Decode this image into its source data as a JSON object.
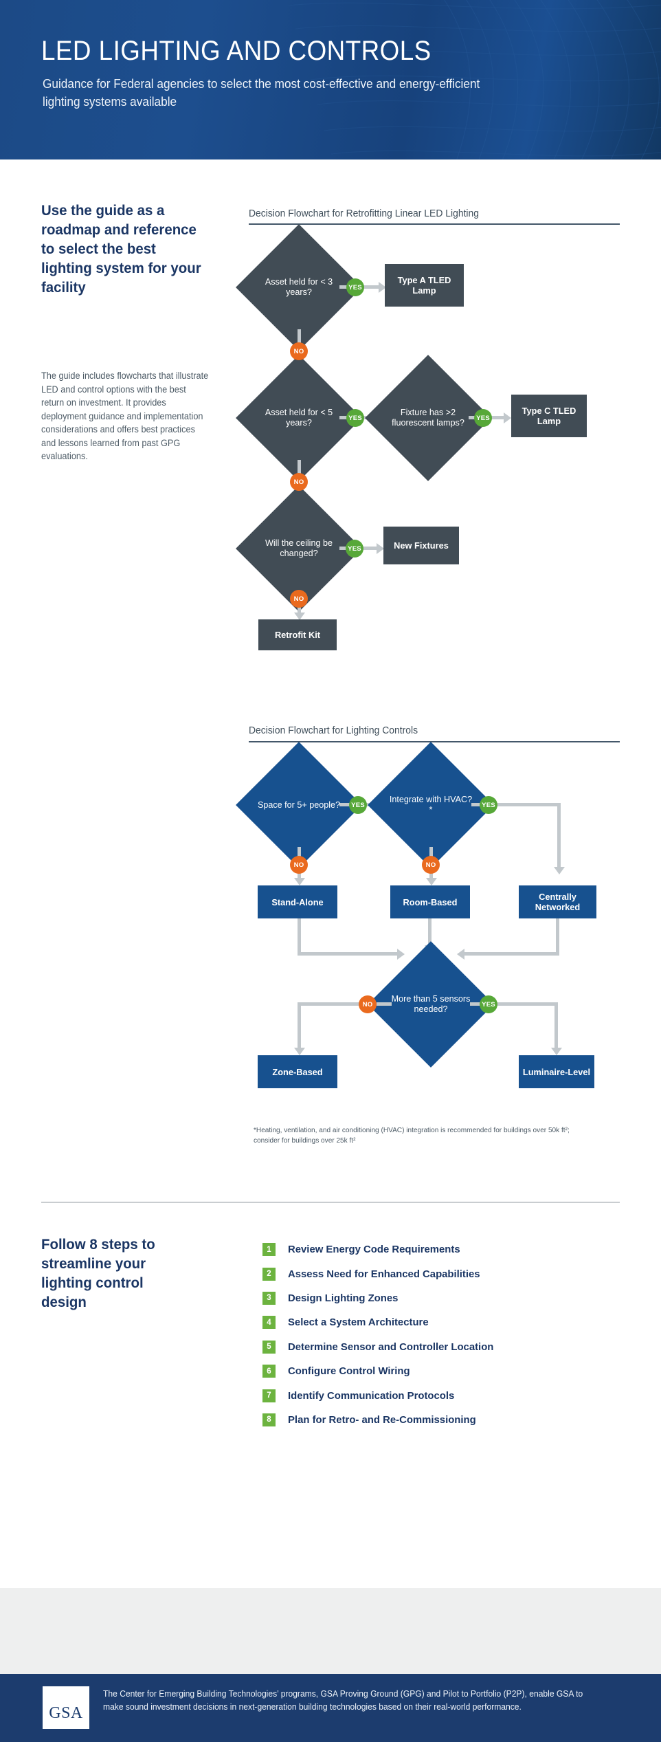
{
  "header": {
    "title": "LED LIGHTING AND CONTROLS",
    "subtitle": "Guidance for Federal agencies to select the most cost-effective and energy-efficient lighting systems available"
  },
  "lead": {
    "heading": "Use the guide as a roadmap and reference to select the best lighting system for your facility",
    "body": "The guide includes flowcharts that illustrate LED and control options with the best return on investment. It provides deployment guidance and implementation considerations and offers best practices and lessons learned from past GPG evaluations."
  },
  "colors": {
    "brand_blue": "#1c3c6e",
    "node_blue": "#17518f",
    "node_dark": "#414c55",
    "yes_green": "#57a838",
    "no_orange": "#ea6a1e",
    "connector_grey": "#c2c8cc",
    "step_green": "#6cb33f"
  },
  "flowchart1": {
    "title": "Decision Flowchart for Retrofitting Linear LED Lighting",
    "nodes": {
      "d1": "Asset held for < 3 years?",
      "r1": "Type A TLED Lamp",
      "d2": "Asset held for < 5 years?",
      "d3": "Fixture has >2 fluorescent lamps?",
      "r2": "Type C TLED Lamp",
      "d4": "Will the ceiling be changed?",
      "r3": "New Fixtures",
      "r4": "Retrofit Kit"
    },
    "badges": {
      "yes1": "YES",
      "no1": "NO",
      "yes2": "YES",
      "yes3": "YES",
      "no2": "NO",
      "yes4": "YES",
      "no3": "NO"
    }
  },
  "flowchart2": {
    "title": "Decision Flowchart for Lighting Controls",
    "nodes": {
      "d1": "Space for 5+ people?",
      "d2": "Integrate with HVAC?*",
      "r1": "Stand-Alone",
      "r2": "Room-Based",
      "r3": "Centrally Networked",
      "d3": "More than 5 sensors needed?",
      "r4": "Zone-Based",
      "r5": "Luminaire-Level"
    },
    "badges": {
      "yes1": "YES",
      "no1": "NO",
      "yes2": "YES",
      "no2": "NO",
      "no3": "NO",
      "yes3": "YES"
    },
    "footnote": "*Heating, ventilation, and air conditioning (HVAC) integration is recommended for buildings over 50k ft²; consider for buildings over 25k ft²"
  },
  "steps_section": {
    "heading": "Follow 8 steps to streamline your lighting control design",
    "steps": [
      {
        "num": "1",
        "label": "Review Energy Code Requirements"
      },
      {
        "num": "2",
        "label": "Assess Need for Enhanced Capabilities"
      },
      {
        "num": "3",
        "label": "Design Lighting Zones"
      },
      {
        "num": "4",
        "label": "Select a System Architecture"
      },
      {
        "num": "5",
        "label": "Determine Sensor and Controller Location"
      },
      {
        "num": "6",
        "label": "Configure Control Wiring"
      },
      {
        "num": "7",
        "label": "Identify Communication Protocols"
      },
      {
        "num": "8",
        "label": "Plan for Retro- and Re-Commissioning"
      }
    ]
  },
  "footer": {
    "logo_text": "GSA",
    "text": "The Center for Emerging Building Technologies’ programs, GSA Proving Ground (GPG) and Pilot to Portfolio (P2P), enable GSA to make sound investment decisions in next-generation building technologies based on their real-world performance."
  }
}
